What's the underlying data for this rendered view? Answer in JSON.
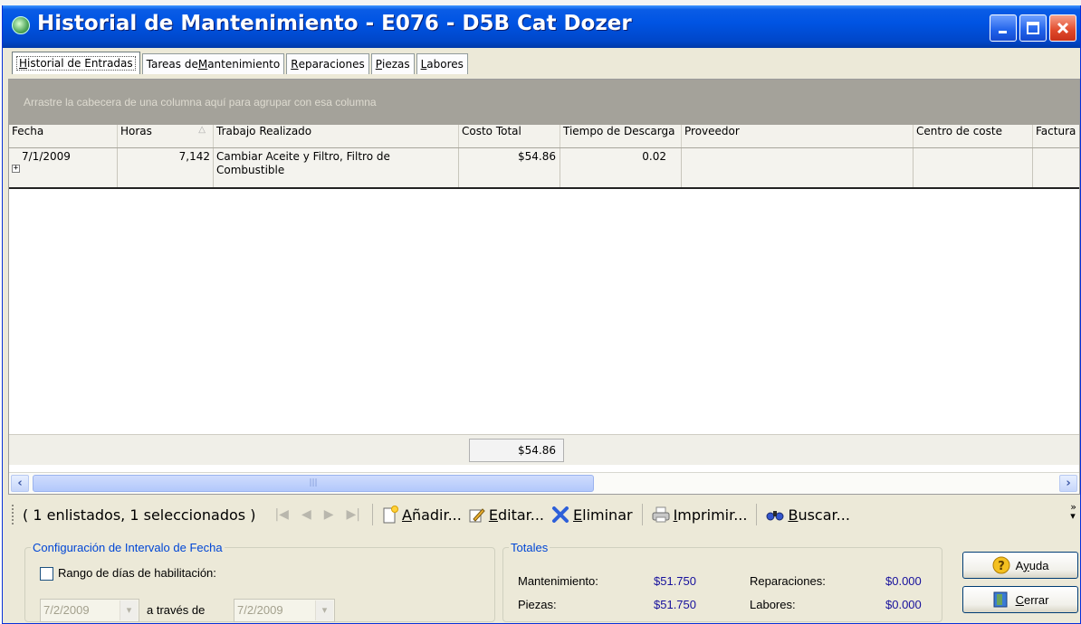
{
  "window": {
    "title": "Historial de Mantenimiento - E076 - D5B Cat Dozer"
  },
  "tabs": [
    {
      "label_pre": "",
      "mn": "H",
      "label_post": "istorial de Entradas"
    },
    {
      "label_pre": "Tareas de ",
      "mn": "M",
      "label_post": "antenimiento"
    },
    {
      "label_pre": "",
      "mn": "R",
      "label_post": "eparaciones"
    },
    {
      "label_pre": "",
      "mn": "P",
      "label_post": "iezas"
    },
    {
      "label_pre": "",
      "mn": "L",
      "label_post": "abores"
    }
  ],
  "grid": {
    "group_hint": "Arrastre la cabecera de una columna aquí para agrupar con esa columna",
    "columns": [
      "Fecha",
      "Horas",
      "Trabajo Realizado",
      "Costo Total",
      "Tiempo de Descarga",
      "Proveedor",
      "Centro de coste",
      "Factura"
    ],
    "sorted_column": "Horas",
    "rows": [
      {
        "fecha": "7/1/2009",
        "horas": "7,142",
        "trabajo": "Cambiar Aceite y Filtro, Filtro de Combustible",
        "costo": "$54.86",
        "tiempo": "0.02",
        "proveedor": "",
        "centro": "",
        "factura": ""
      }
    ],
    "footer_total": "$54.86"
  },
  "toolbar": {
    "status": "( 1 enlistados, 1 seleccionados )",
    "add": {
      "mn": "A",
      "rest": "ñadir..."
    },
    "edit": {
      "mn": "E",
      "rest": "ditar..."
    },
    "delete": {
      "mn": "E",
      "rest": "liminar"
    },
    "print": {
      "mn": "I",
      "rest": "mprimir..."
    },
    "find": {
      "mn": "B",
      "rest": "uscar..."
    }
  },
  "date_config": {
    "legend": "Configuración de Intervalo de Fecha",
    "checkbox_label": "Rango de días de habilitación:",
    "checked": false,
    "from_date": "7/2/2009",
    "through_label": "a través de",
    "to_date": "7/2/2009"
  },
  "totals": {
    "legend": "Totales",
    "mantenimiento_label": "Mantenimiento:",
    "mantenimiento_value": "$51.750",
    "reparaciones_label": "Reparaciones:",
    "reparaciones_value": "$0.000",
    "piezas_label": "Piezas:",
    "piezas_value": "$51.750",
    "labores_label": "Labores:",
    "labores_value": "$0.000"
  },
  "buttons": {
    "help": {
      "pre": "A",
      "mn": "y",
      "rest": "uda"
    },
    "close": {
      "mn": "C",
      "rest": "errar"
    }
  },
  "colors": {
    "title_bar": "#0054e3",
    "group_panel": "#a4a29a",
    "totals_value": "#16109c",
    "legend": "#0046d5"
  }
}
